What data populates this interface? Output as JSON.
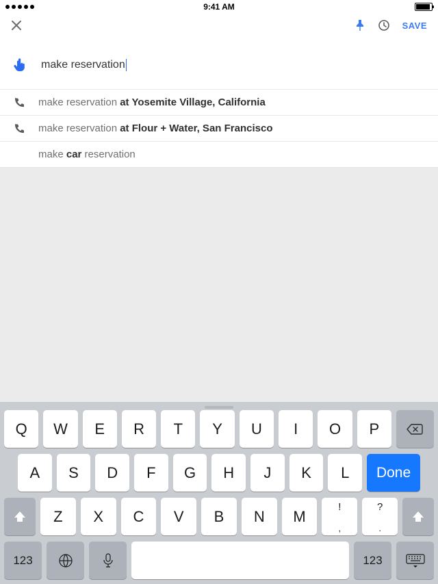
{
  "status": {
    "time": "9:41 AM"
  },
  "header": {
    "save_label": "SAVE"
  },
  "search": {
    "text": "make reservation"
  },
  "suggestions": [
    {
      "icon": "phone",
      "prefix": "make reservation ",
      "bold": "at Yosemite Village, California",
      "suffix": ""
    },
    {
      "icon": "phone",
      "prefix": "make reservation ",
      "bold": "at Flour + Water, San Francisco",
      "suffix": ""
    },
    {
      "icon": "",
      "prefix": "make ",
      "bold": "car",
      "suffix": " reservation"
    }
  ],
  "keyboard": {
    "row1": [
      "Q",
      "W",
      "E",
      "R",
      "T",
      "Y",
      "U",
      "I",
      "O",
      "P"
    ],
    "row2": [
      "A",
      "S",
      "D",
      "F",
      "G",
      "H",
      "J",
      "K",
      "L"
    ],
    "row3": [
      "Z",
      "X",
      "C",
      "V",
      "B",
      "N",
      "M"
    ],
    "done": "Done",
    "num": "123",
    "punct1_top": "!",
    "punct1_bot": ",",
    "punct2_top": "?",
    "punct2_bot": "."
  }
}
